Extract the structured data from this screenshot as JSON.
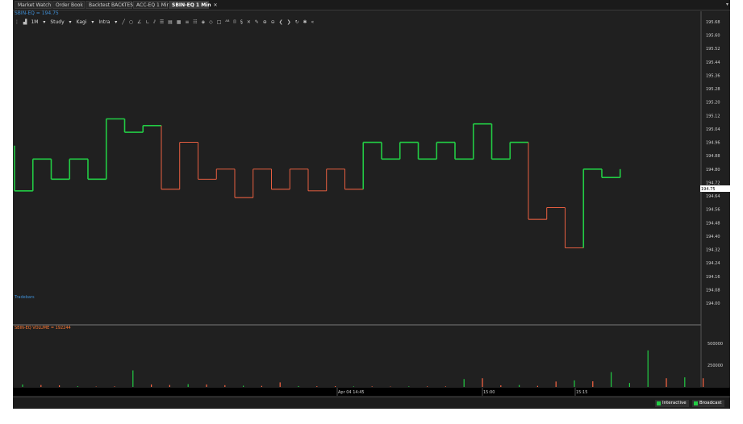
{
  "tabs": [
    {
      "label": "Market Watch",
      "active": false
    },
    {
      "label": "Order Book",
      "active": false
    },
    {
      "label": "Backtest BACKTEST...",
      "active": false
    },
    {
      "label": "ACC-EQ 1 Min",
      "active": false
    },
    {
      "label": "SBIN-EQ 1 Min",
      "active": true
    }
  ],
  "tab_menu_glyph": "▾",
  "symbol_line": "SBIN-EQ = 194.75",
  "toolbar": {
    "interval": "1M",
    "study": "Study",
    "chart_type": "Kagi",
    "intra": "Intra"
  },
  "tradebars_label": "Tradebars",
  "volume_label": "SBIN-EQ VOLUME = 192244",
  "current_price_label": "194.75",
  "price_axis_labels": [
    "195.68",
    "195.60",
    "195.52",
    "195.44",
    "195.36",
    "195.28",
    "195.20",
    "195.12",
    "195.04",
    "194.96",
    "194.88",
    "194.80",
    "194.72",
    "194.64",
    "194.56",
    "194.48",
    "194.40",
    "194.32",
    "194.24",
    "194.16",
    "194.08",
    "194.00"
  ],
  "volume_axis_labels": [
    "500000",
    "250000"
  ],
  "time_labels": [
    "Apr 04 14:45",
    "15:00",
    "15:15"
  ],
  "status": {
    "interactive": "Interactive",
    "broadcast": "Broadcast"
  },
  "colors": {
    "up": "#22cc44",
    "down": "#ff6644",
    "background": "#202020",
    "accent": "#3f8fd6",
    "volume_title": "#ff7a33"
  },
  "chart_data": {
    "type": "line",
    "style": "kagi",
    "title": "SBIN-EQ 1 Min",
    "price_range": [
      194.0,
      195.68
    ],
    "kagi_points": [
      194.94,
      194.67,
      194.86,
      194.74,
      194.86,
      194.74,
      195.1,
      195.02,
      195.06,
      194.68,
      194.96,
      194.74,
      194.8,
      194.63,
      194.8,
      194.68,
      194.8,
      194.67,
      194.8,
      194.68,
      194.96,
      194.86,
      194.96,
      194.86,
      194.96,
      194.86,
      195.07,
      194.86,
      194.96,
      194.5,
      194.57,
      194.33,
      194.8,
      194.75,
      194.8
    ],
    "volume_range": [
      0,
      700000
    ],
    "volume": [
      28000,
      22000,
      18000,
      8000,
      4000,
      6000,
      190000,
      28000,
      22000,
      32000,
      28000,
      20000,
      14000,
      12000,
      52000,
      10000,
      8000,
      9000,
      6000,
      6000,
      4000,
      6000,
      6000,
      6000,
      90000,
      100000,
      18000,
      22000,
      12000,
      62000,
      75000,
      65000,
      170000,
      45000,
      420000,
      100000,
      110000,
      100000
    ],
    "time_labels": [
      "Apr 04 14:45",
      "15:00",
      "15:15"
    ]
  }
}
